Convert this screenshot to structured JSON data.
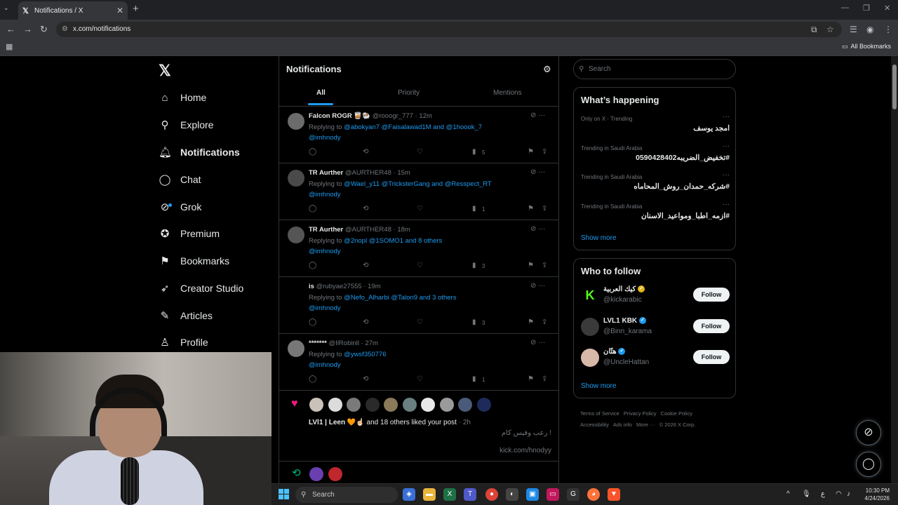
{
  "browser": {
    "tab_title": "Notifications / X",
    "url": "x.com/notifications",
    "all_bookmarks": "All Bookmarks"
  },
  "nav": {
    "items": [
      {
        "label": "Home",
        "icon": "home-icon"
      },
      {
        "label": "Explore",
        "icon": "search-icon"
      },
      {
        "label": "Notifications",
        "icon": "bell-icon"
      },
      {
        "label": "Chat",
        "icon": "chat-icon"
      },
      {
        "label": "Grok",
        "icon": "grok-icon"
      },
      {
        "label": "Premium",
        "icon": "premium-icon"
      },
      {
        "label": "Bookmarks",
        "icon": "bookmark-icon"
      },
      {
        "label": "Creator Studio",
        "icon": "rocket-icon"
      },
      {
        "label": "Articles",
        "icon": "articles-icon"
      },
      {
        "label": "Profile",
        "icon": "person-icon"
      }
    ]
  },
  "notifications": {
    "title": "Notifications",
    "tabs": [
      "All",
      "Priority",
      "Mentions"
    ],
    "posts": [
      {
        "name": "Falcon ROGR",
        "emoji": "🥃🐏",
        "handle": "@rooogr_777",
        "time": "12m",
        "replying_prefix": "Replying to",
        "mentions": "@abokyan7 @Faisalawad1M and @1hoook_7",
        "mention2": "@imhnody",
        "views": "5"
      },
      {
        "name": "TR Aurther",
        "emoji": "",
        "handle": "@AURTHER48",
        "time": "15m",
        "replying_prefix": "Replying to",
        "mentions": "@Wael_y11 @TricksterGang and @Resspect_RT",
        "mention2": "@imhnody",
        "views": "1"
      },
      {
        "name": "TR Aurther",
        "emoji": "",
        "handle": "@AURTHER48",
        "time": "18m",
        "replying_prefix": "Replying to",
        "mentions": "@2nopl @1SOMO1 and 8 others",
        "mention2": "@imhnody",
        "views": "3"
      },
      {
        "name": "is",
        "emoji": "",
        "handle": "@rubyae27555",
        "time": "19m",
        "replying_prefix": "Replying to",
        "mentions": "@Nefo_Alharbi @Talon9 and 3 others",
        "mention2": "@imhnody",
        "views": "3"
      },
      {
        "name": "*******",
        "emoji": "",
        "handle": "@IlRobinll",
        "time": "27m",
        "replying_prefix": "Replying to",
        "mentions": "@ywsf350776",
        "mention2": "@imhnody",
        "views": "1"
      }
    ],
    "likes": {
      "name": "LVl1 | Leen",
      "emoji": "🧡☝🏻",
      "text": "and 18 others liked your post",
      "time": "2h",
      "snippet": "رعب وفيس كام !",
      "link": "kick.com/hnodyy"
    }
  },
  "search": {
    "placeholder": "Search"
  },
  "happening": {
    "title": "What’s happening",
    "trends": [
      {
        "context": "Only on X · Trending",
        "name": "امجد يوسف"
      },
      {
        "context": "Trending in Saudi Arabia",
        "name": "#تخفيض_الضريبه0590428402"
      },
      {
        "context": "Trending in Saudi Arabia",
        "name": "#شركه_حمدان_روش_المحاماه"
      },
      {
        "context": "Trending in Saudi Arabia",
        "name": "#ازمه_اطبا_ومواعيد_الاسنان"
      }
    ],
    "show_more": "Show more"
  },
  "who_to_follow": {
    "title": "Who to follow",
    "accounts": [
      {
        "name": "كيك العربية",
        "handle": "@kickarabic",
        "button": "Follow"
      },
      {
        "name": "LVL1 KBK",
        "handle": "@Binn_karama",
        "button": "Follow"
      },
      {
        "name": "هتّان",
        "handle": "@UncleHattan",
        "button": "Follow"
      }
    ],
    "show_more": "Show more"
  },
  "footer": {
    "links": [
      "Terms of Service",
      "Privacy Policy",
      "Cookie Policy",
      "Accessibility",
      "Ads info",
      "More ···",
      "© 2026 X Corp."
    ]
  },
  "taskbar": {
    "search": "Search",
    "time": "10:30 PM",
    "date": "4/24/2026",
    "lang": "ع"
  },
  "colors": {
    "accent": "#1d9bf0",
    "like": "#f91880",
    "repost": "#00ba7c",
    "verified_gold": "#e2b719"
  }
}
